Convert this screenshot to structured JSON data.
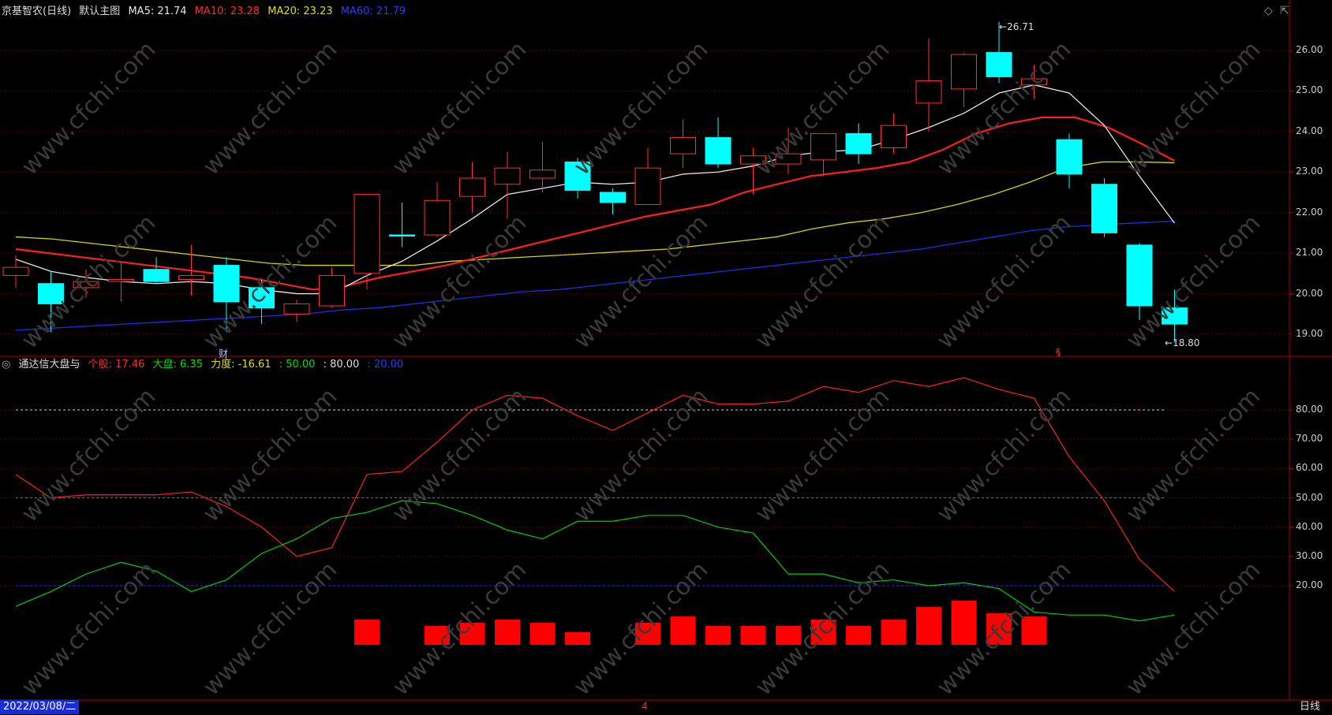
{
  "colors": {
    "up": "#ff3030",
    "down": "#00ffff",
    "ma5": "#e6e6e6",
    "ma10": "#ff1e1e",
    "ma20": "#d4d400",
    "ma60": "#1e2ee6",
    "frame": "#b00000",
    "stock_line": "#ff2020",
    "market_line": "#00d000"
  },
  "main_panel": {
    "stock_label": "京基智农(日线)",
    "chart_label": "默认主图",
    "ma5": "MA5: 21.74",
    "ma10": "MA10: 23.28",
    "ma20": "MA20: 23.23",
    "ma60": "MA60: 21.79",
    "high_marker": "26.71",
    "low_marker": "18.80",
    "financial_marker": "财",
    "event_marker": "§",
    "y_ticks": [
      "26.00",
      "25.00",
      "24.00",
      "23.00",
      "22.00",
      "21.00",
      "20.00",
      "19.00"
    ]
  },
  "sub_panel": {
    "indicator_label": "通达信大盘与",
    "stock_value": "个股: 17.46",
    "market_value": "大盘: 6.35",
    "force_value": "力度: -16.61",
    "level_50": ": 50.00",
    "level_80": ": 80.00",
    "level_20": ": 20.00",
    "y_ticks": [
      "80.00",
      "70.00",
      "60.00",
      "50.00",
      "40.00",
      "30.00",
      "20.00"
    ]
  },
  "bottom_bar": {
    "date": "2022/03/08/二",
    "month_marker": "4",
    "period": "日线"
  },
  "watermark": "www.cfchi.com",
  "chart_data": {
    "type": "candlestick",
    "candles": [
      {
        "o": 20.45,
        "c": 20.65,
        "h": 20.95,
        "l": 20.15
      },
      {
        "o": 20.25,
        "c": 19.75,
        "h": 20.55,
        "l": 19.05
      },
      {
        "o": 20.15,
        "c": 20.3,
        "h": 20.6,
        "l": 19.9
      },
      {
        "o": 20.3,
        "c": 20.35,
        "h": 20.8,
        "l": 19.8
      },
      {
        "o": 20.6,
        "c": 20.3,
        "h": 20.9,
        "l": 20.25
      },
      {
        "o": 20.35,
        "c": 20.45,
        "h": 21.2,
        "l": 19.95
      },
      {
        "o": 20.7,
        "c": 19.8,
        "h": 20.9,
        "l": 19.05
      },
      {
        "o": 20.15,
        "c": 19.65,
        "h": 20.35,
        "l": 19.25
      },
      {
        "o": 19.5,
        "c": 19.75,
        "h": 19.85,
        "l": 19.3
      },
      {
        "o": 19.7,
        "c": 20.45,
        "h": 20.65,
        "l": 19.65
      },
      {
        "o": 20.5,
        "c": 22.45,
        "h": 22.45,
        "l": 20.1
      },
      {
        "o": 21.45,
        "c": 21.42,
        "h": 22.25,
        "l": 21.15
      },
      {
        "o": 21.45,
        "c": 22.3,
        "h": 22.75,
        "l": 21.4
      },
      {
        "o": 22.4,
        "c": 22.85,
        "h": 23.25,
        "l": 22.0
      },
      {
        "o": 22.7,
        "c": 23.1,
        "h": 23.5,
        "l": 21.85
      },
      {
        "o": 22.85,
        "c": 23.05,
        "h": 23.75,
        "l": 22.5
      },
      {
        "o": 23.25,
        "c": 22.55,
        "h": 23.35,
        "l": 22.35
      },
      {
        "o": 22.5,
        "c": 22.25,
        "h": 22.6,
        "l": 21.95
      },
      {
        "o": 22.2,
        "c": 23.1,
        "h": 23.6,
        "l": 22.2
      },
      {
        "o": 23.45,
        "c": 23.85,
        "h": 24.3,
        "l": 23.1
      },
      {
        "o": 23.85,
        "c": 23.2,
        "h": 24.35,
        "l": 23.1
      },
      {
        "o": 23.2,
        "c": 23.4,
        "h": 23.6,
        "l": 22.45
      },
      {
        "o": 23.2,
        "c": 23.45,
        "h": 24.1,
        "l": 22.95
      },
      {
        "o": 23.3,
        "c": 23.95,
        "h": 23.95,
        "l": 22.9
      },
      {
        "o": 23.95,
        "c": 23.45,
        "h": 24.2,
        "l": 23.2
      },
      {
        "o": 23.6,
        "c": 24.15,
        "h": 24.45,
        "l": 23.45
      },
      {
        "o": 24.7,
        "c": 25.25,
        "h": 26.3,
        "l": 24.0
      },
      {
        "o": 25.05,
        "c": 25.9,
        "h": 25.95,
        "l": 24.6
      },
      {
        "o": 25.95,
        "c": 25.35,
        "h": 26.71,
        "l": 25.2
      },
      {
        "o": 25.15,
        "c": 25.3,
        "h": 25.65,
        "l": 24.8
      },
      {
        "o": 23.8,
        "c": 22.95,
        "h": 23.95,
        "l": 22.6
      },
      {
        "o": 22.7,
        "c": 21.5,
        "h": 22.85,
        "l": 21.4
      },
      {
        "o": 21.2,
        "c": 19.7,
        "h": 21.25,
        "l": 19.35
      },
      {
        "o": 19.65,
        "c": 19.25,
        "h": 20.1,
        "l": 18.8
      }
    ],
    "ma5": [
      20.85,
      20.55,
      20.4,
      20.3,
      20.25,
      20.3,
      20.25,
      20.1,
      20.0,
      20.0,
      20.45,
      20.8,
      21.3,
      21.85,
      22.45,
      22.6,
      22.75,
      22.7,
      22.75,
      22.95,
      23.0,
      23.15,
      23.4,
      23.5,
      23.55,
      23.8,
      24.1,
      24.45,
      24.95,
      25.15,
      24.95,
      24.15,
      22.9,
      21.74
    ],
    "ma10": [
      21.1,
      21.0,
      20.9,
      20.8,
      20.7,
      20.6,
      20.5,
      20.4,
      20.25,
      20.1,
      20.2,
      20.4,
      20.55,
      20.7,
      20.9,
      21.1,
      21.3,
      21.5,
      21.7,
      21.9,
      22.05,
      22.2,
      22.5,
      22.7,
      22.9,
      23.0,
      23.1,
      23.25,
      23.55,
      23.95,
      24.2,
      24.35,
      24.35,
      24.1,
      23.7,
      23.28
    ],
    "ma20": [
      21.4,
      21.35,
      21.25,
      21.15,
      21.05,
      20.95,
      20.85,
      20.75,
      20.7,
      20.7,
      20.7,
      20.7,
      20.8,
      20.85,
      20.9,
      20.95,
      21.0,
      21.05,
      21.1,
      21.2,
      21.3,
      21.4,
      21.6,
      21.75,
      21.85,
      22.0,
      22.2,
      22.45,
      22.75,
      23.1,
      23.25,
      23.25,
      23.23
    ],
    "ma60": [
      19.1,
      19.15,
      19.2,
      19.25,
      19.3,
      19.35,
      19.4,
      19.45,
      19.5,
      19.6,
      19.65,
      19.75,
      19.85,
      19.95,
      20.05,
      20.1,
      20.2,
      20.3,
      20.4,
      20.5,
      20.6,
      20.7,
      20.8,
      20.9,
      21.0,
      21.1,
      21.25,
      21.4,
      21.55,
      21.65,
      21.7,
      21.75,
      21.79
    ],
    "stock_ratio": [
      58,
      50,
      51,
      51,
      51,
      52,
      47,
      40,
      30,
      33,
      58,
      59,
      69,
      80,
      85,
      84,
      78,
      73,
      79,
      85,
      82,
      82,
      83,
      88,
      86,
      90,
      88,
      91,
      87,
      84,
      64,
      49,
      29,
      18
    ],
    "market_ratio": [
      13,
      18,
      24,
      28,
      25,
      18,
      22,
      31,
      36,
      43,
      45,
      49,
      48,
      44,
      39,
      36,
      42,
      42,
      44,
      44,
      40,
      38,
      24,
      24,
      21,
      22,
      20,
      21,
      19,
      11,
      10,
      10,
      8,
      10
    ],
    "force_bars": [
      0,
      0,
      0,
      0,
      0,
      0,
      0,
      0,
      0,
      0,
      8,
      0,
      6,
      7,
      8,
      7,
      4,
      0,
      7,
      9,
      6,
      6,
      6,
      8,
      6,
      8,
      12,
      14,
      10,
      9,
      0,
      0,
      0,
      0
    ],
    "levels": [
      80,
      50,
      20
    ]
  }
}
